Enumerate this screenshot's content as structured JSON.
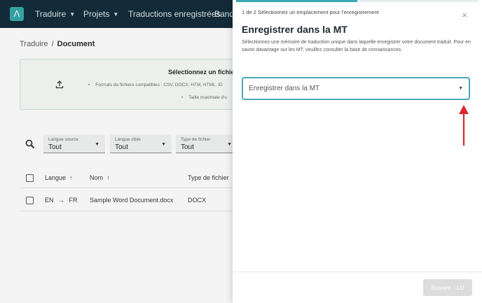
{
  "colors": {
    "topbar_bg": "#0b2433",
    "accent": "#3aa7b3",
    "annotation_arrow": "#d9262a",
    "disabled_button": "#dcdcdc"
  },
  "topbar": {
    "logo_glyph": "Λ",
    "nav": [
      {
        "label": "Traduire",
        "has_dropdown": true
      },
      {
        "label": "Projets",
        "has_dropdown": true
      },
      {
        "label": "Traductions enregistrées",
        "has_dropdown": false
      },
      {
        "label": "Banqu",
        "has_dropdown": false
      }
    ]
  },
  "breadcrumb": {
    "parent": "Traduire",
    "separator": "/",
    "current": "Document"
  },
  "upload": {
    "icon": "upload-icon",
    "title": "Sélectionnez un fichier, c",
    "formats": "Formats de fichiers compatibles : CSV, DOCX, HTM, HTML, ID",
    "max_size": "Taille maximale d'u",
    "bullet": "•"
  },
  "filters": [
    {
      "label": "Langue source",
      "value": "Tout"
    },
    {
      "label": "Langue cible",
      "value": "Tout"
    },
    {
      "label": "Type de fichier",
      "value": "Tout"
    }
  ],
  "table": {
    "columns": [
      "Langue",
      "Nom",
      "Type de fichier"
    ],
    "rows": [
      {
        "source": "EN",
        "arrow": "→",
        "target": "FR",
        "name": "Sample Word Document.docx",
        "type": "DOCX"
      }
    ]
  },
  "panel": {
    "progress": 0.5,
    "step_label": "1 de 2 Sélectionnez un emplacement pour l'enregistrement",
    "close_glyph": "×",
    "title": "Enregistrer dans la MT",
    "description": "Sélectionnez une mémoire de traduction unique dans laquelle enregistrer votre document traduit. Pour en savoir davantage sur les MT, veuillez consulter la base de connaissances.",
    "select_value": "Enregistrer dans la MT",
    "next_button": "Suivant · 1/2"
  }
}
